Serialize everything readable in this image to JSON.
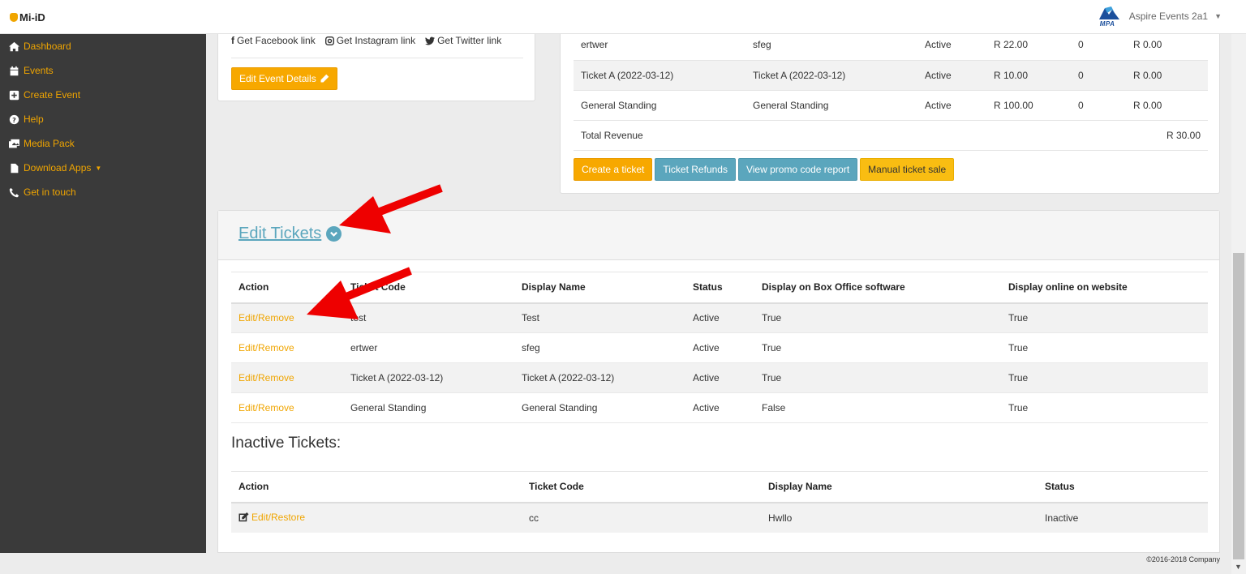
{
  "brand": {
    "name": "Mi-iD"
  },
  "user_menu": {
    "logo_text": "MPA",
    "account": "Aspire Events 2a1"
  },
  "sidebar": {
    "items": [
      {
        "label": "Dashboard",
        "icon": "home-icon"
      },
      {
        "label": "Events",
        "icon": "calendar-icon"
      },
      {
        "label": "Create Event",
        "icon": "plus-square-icon"
      },
      {
        "label": "Help",
        "icon": "question-circle-icon"
      },
      {
        "label": "Media Pack",
        "icon": "images-icon"
      },
      {
        "label": "Download Apps",
        "icon": "file-icon",
        "has_dropdown": true
      },
      {
        "label": "Get in touch",
        "icon": "phone-icon"
      }
    ]
  },
  "social": {
    "facebook": "Get Facebook link",
    "instagram": "Get Instagram link",
    "twitter": "Get Twitter link",
    "edit_button": "Edit Event Details"
  },
  "revenue": {
    "rows": [
      {
        "ticket": "ertwer",
        "display": "sfeg",
        "status": "Active",
        "price": "R 22.00",
        "sold": "0",
        "revenue": "R 0.00"
      },
      {
        "ticket": "Ticket A (2022-03-12)",
        "display": "Ticket A (2022-03-12)",
        "status": "Active",
        "price": "R 10.00",
        "sold": "0",
        "revenue": "R 0.00"
      },
      {
        "ticket": "General Standing",
        "display": "General Standing",
        "status": "Active",
        "price": "R 100.00",
        "sold": "0",
        "revenue": "R 0.00"
      }
    ],
    "total_label": "Total Revenue",
    "total_value": "R 30.00",
    "buttons": {
      "create": "Create a ticket",
      "refunds": "Ticket Refunds",
      "promo": "View promo code report",
      "manual": "Manual ticket sale"
    }
  },
  "tickets": {
    "title": "Edit Tickets",
    "headers": [
      "Action",
      "Ticket Code",
      "Display Name",
      "Status",
      "Display on Box Office software",
      "Display online on website"
    ],
    "rows": [
      {
        "action": "Edit/Remove",
        "code": "test",
        "display": "Test",
        "status": "Active",
        "box_office": "True",
        "online": "True"
      },
      {
        "action": "Edit/Remove",
        "code": "ertwer",
        "display": "sfeg",
        "status": "Active",
        "box_office": "True",
        "online": "True"
      },
      {
        "action": "Edit/Remove",
        "code": "Ticket A (2022-03-12)",
        "display": "Ticket A (2022-03-12)",
        "status": "Active",
        "box_office": "True",
        "online": "True"
      },
      {
        "action": "Edit/Remove",
        "code": "General Standing",
        "display": "General Standing",
        "status": "Active",
        "box_office": "False",
        "online": "True"
      }
    ]
  },
  "inactive": {
    "title": "Inactive Tickets:",
    "headers": [
      "Action",
      "Ticket Code",
      "Display Name",
      "Status"
    ],
    "rows": [
      {
        "action": "Edit/Restore",
        "code": "cc",
        "display": "Hwllo",
        "status": "Inactive"
      }
    ]
  },
  "footer": {
    "copyright": "©2016-2018 Company"
  },
  "colors": {
    "accent": "#f0a500",
    "teal": "#5ba6bd",
    "sidebar": "#3a3a3a",
    "arrow": "#ee0000"
  }
}
